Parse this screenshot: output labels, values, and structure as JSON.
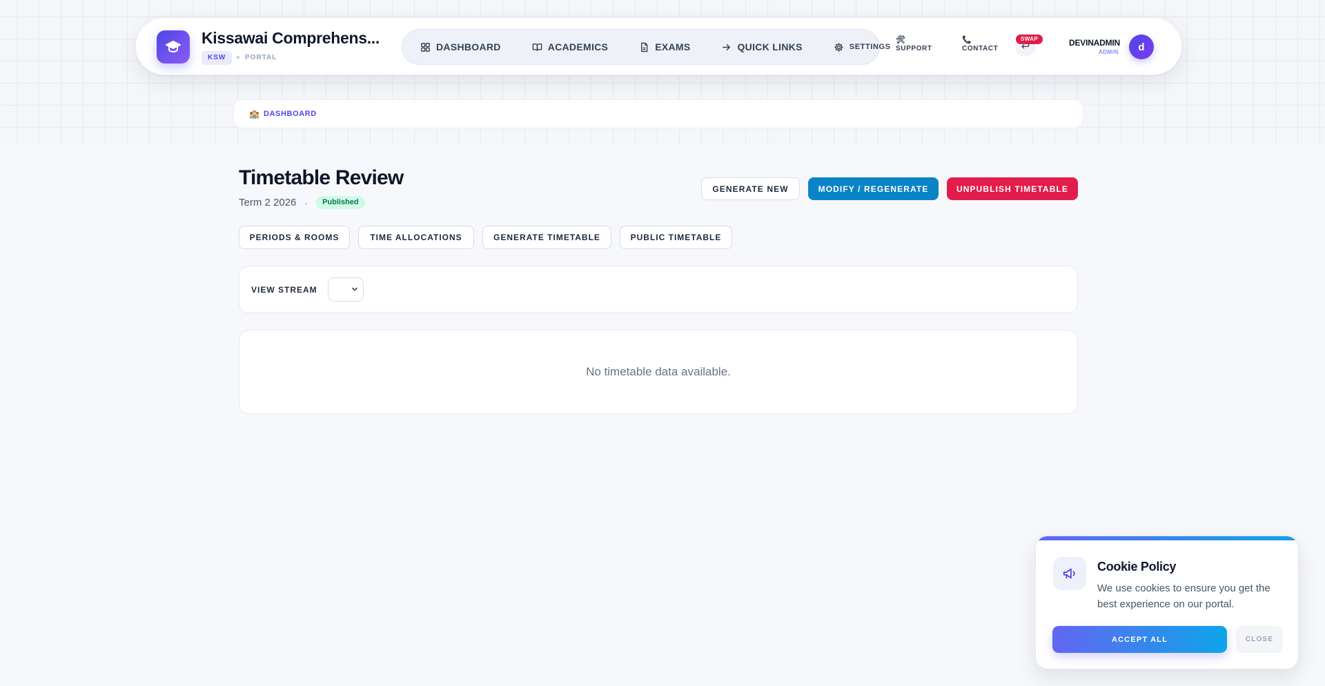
{
  "header": {
    "school_name": "Kissawai Comprehens...",
    "school_code": "KSW",
    "portal_label": "PORTAL",
    "nav": [
      {
        "label": "DASHBOARD",
        "icon": "grid-icon"
      },
      {
        "label": "ACADEMICS",
        "icon": "book-icon"
      },
      {
        "label": "EXAMS",
        "icon": "document-icon"
      },
      {
        "label": "QUICK LINKS",
        "icon": "arrow-right-icon"
      },
      {
        "label": "SETTINGS",
        "icon": "gear-icon"
      }
    ],
    "support_label": "SUPPORT",
    "contact_label": "CONTACT",
    "swap_label": "SWAP",
    "user_name": "DEVINADMIN",
    "user_role": "ADMIN",
    "avatar_initial": "d"
  },
  "breadcrumb": {
    "label": "DASHBOARD"
  },
  "page": {
    "title": "Timetable Review",
    "term": "Term 2 2026",
    "separator": "·",
    "status": "Published",
    "actions": {
      "generate_new": "GENERATE NEW",
      "modify": "MODIFY / REGENERATE",
      "unpublish": "UNPUBLISH TIMETABLE"
    },
    "tabs": [
      "PERIODS & ROOMS",
      "TIME ALLOCATIONS",
      "GENERATE TIMETABLE",
      "PUBLIC TIMETABLE"
    ],
    "filter": {
      "label": "VIEW STREAM",
      "selected": ""
    },
    "empty_message": "No timetable data available."
  },
  "cookie": {
    "title": "Cookie Policy",
    "text": "We use cookies to ensure you get the best experience on our portal.",
    "accept_label": "ACCEPT ALL",
    "close_label": "CLOSE"
  },
  "colors": {
    "brand": "#4f46e5",
    "primary_action": "#0a84c7",
    "danger_action": "#e21d4b",
    "published_badge": "#d1fae5"
  }
}
